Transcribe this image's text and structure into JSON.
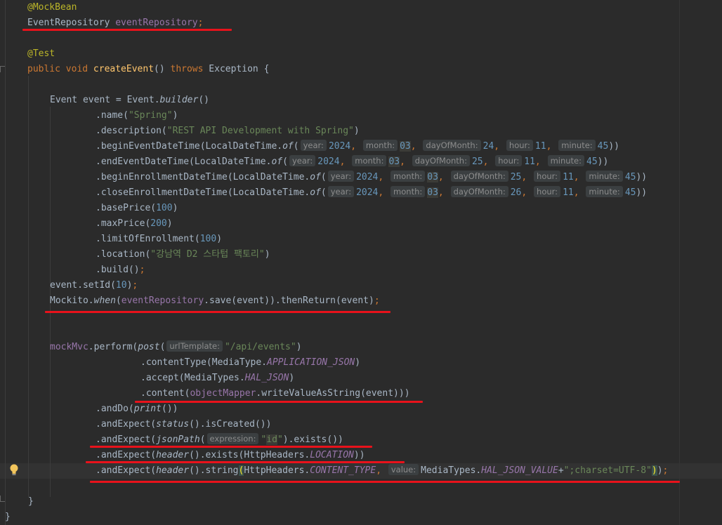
{
  "editor": {
    "lines": [
      {
        "tokens": [
          {
            "t": "@MockBean",
            "c": "ann"
          }
        ]
      },
      {
        "tokens": [
          {
            "t": "EventRepository ",
            "c": "plain"
          },
          {
            "t": "eventRepository",
            "c": "field"
          },
          {
            "t": ";",
            "c": "kw"
          }
        ]
      },
      {
        "tokens": []
      },
      {
        "tokens": [
          {
            "t": "@Test",
            "c": "ann"
          }
        ]
      },
      {
        "tokens": [
          {
            "t": "public void ",
            "c": "kw"
          },
          {
            "t": "createEvent",
            "c": "fn"
          },
          {
            "t": "() ",
            "c": "plain"
          },
          {
            "t": "throws ",
            "c": "kw"
          },
          {
            "t": "Exception {",
            "c": "plain"
          }
        ]
      },
      {
        "tokens": []
      },
      {
        "tokens": [
          {
            "t": "Event event = Event.",
            "c": "plain"
          },
          {
            "t": "builder",
            "c": "plain it"
          },
          {
            "t": "()",
            "c": "plain"
          }
        ]
      },
      {
        "tokens": [
          {
            "t": ".name(",
            "c": "plain"
          },
          {
            "t": "\"Spring\"",
            "c": "str"
          },
          {
            "t": ")",
            "c": "plain"
          }
        ]
      },
      {
        "tokens": [
          {
            "t": ".description(",
            "c": "plain"
          },
          {
            "t": "\"REST API Development with Spring\"",
            "c": "str"
          },
          {
            "t": ")",
            "c": "plain"
          }
        ]
      },
      {
        "tokens": [
          {
            "t": ".beginEventDateTime(LocalDateTime.",
            "c": "plain"
          },
          {
            "t": "of",
            "c": "plain it"
          },
          {
            "t": "(",
            "c": "plain"
          },
          {
            "h": "year:"
          },
          {
            "t": "2024",
            "c": "num"
          },
          {
            "t": ", ",
            "c": "kw"
          },
          {
            "h": "month:"
          },
          {
            "t": "03",
            "c": "num hl"
          },
          {
            "t": ", ",
            "c": "kw"
          },
          {
            "h": "dayOfMonth:"
          },
          {
            "t": "24",
            "c": "num"
          },
          {
            "t": ", ",
            "c": "kw"
          },
          {
            "h": "hour:"
          },
          {
            "t": "11",
            "c": "num"
          },
          {
            "t": ", ",
            "c": "kw"
          },
          {
            "h": "minute:"
          },
          {
            "t": "45",
            "c": "num"
          },
          {
            "t": "))",
            "c": "plain"
          }
        ]
      },
      {
        "tokens": [
          {
            "t": ".endEventDateTime(LocalDateTime.",
            "c": "plain"
          },
          {
            "t": "of",
            "c": "plain it"
          },
          {
            "t": "(",
            "c": "plain"
          },
          {
            "h": "year:"
          },
          {
            "t": "2024",
            "c": "num"
          },
          {
            "t": ", ",
            "c": "kw"
          },
          {
            "h": "month:"
          },
          {
            "t": "03",
            "c": "num hl"
          },
          {
            "t": ", ",
            "c": "kw"
          },
          {
            "h": "dayOfMonth:"
          },
          {
            "t": "25",
            "c": "num"
          },
          {
            "t": ", ",
            "c": "kw"
          },
          {
            "h": "hour:"
          },
          {
            "t": "11",
            "c": "num"
          },
          {
            "t": ", ",
            "c": "kw"
          },
          {
            "h": "minute:"
          },
          {
            "t": "45",
            "c": "num"
          },
          {
            "t": "))",
            "c": "plain"
          }
        ]
      },
      {
        "tokens": [
          {
            "t": ".beginEnrollmentDateTime(LocalDateTime.",
            "c": "plain"
          },
          {
            "t": "of",
            "c": "plain it"
          },
          {
            "t": "(",
            "c": "plain"
          },
          {
            "h": "year:"
          },
          {
            "t": "2024",
            "c": "num"
          },
          {
            "t": ", ",
            "c": "kw"
          },
          {
            "h": "month:"
          },
          {
            "t": "03",
            "c": "num hl"
          },
          {
            "t": ", ",
            "c": "kw"
          },
          {
            "h": "dayOfMonth:"
          },
          {
            "t": "25",
            "c": "num"
          },
          {
            "t": ", ",
            "c": "kw"
          },
          {
            "h": "hour:"
          },
          {
            "t": "11",
            "c": "num"
          },
          {
            "t": ", ",
            "c": "kw"
          },
          {
            "h": "minute:"
          },
          {
            "t": "45",
            "c": "num"
          },
          {
            "t": "))",
            "c": "plain"
          }
        ]
      },
      {
        "tokens": [
          {
            "t": ".closeEnrollmentDateTime(LocalDateTime.",
            "c": "plain"
          },
          {
            "t": "of",
            "c": "plain it"
          },
          {
            "t": "(",
            "c": "plain"
          },
          {
            "h": "year:"
          },
          {
            "t": "2024",
            "c": "num"
          },
          {
            "t": ", ",
            "c": "kw"
          },
          {
            "h": "month:"
          },
          {
            "t": "03",
            "c": "num hl"
          },
          {
            "t": ", ",
            "c": "kw"
          },
          {
            "h": "dayOfMonth:"
          },
          {
            "t": "26",
            "c": "num"
          },
          {
            "t": ", ",
            "c": "kw"
          },
          {
            "h": "hour:"
          },
          {
            "t": "11",
            "c": "num"
          },
          {
            "t": ", ",
            "c": "kw"
          },
          {
            "h": "minute:"
          },
          {
            "t": "45",
            "c": "num"
          },
          {
            "t": "))",
            "c": "plain"
          }
        ]
      },
      {
        "tokens": [
          {
            "t": ".basePrice(",
            "c": "plain"
          },
          {
            "t": "100",
            "c": "num"
          },
          {
            "t": ")",
            "c": "plain"
          }
        ]
      },
      {
        "tokens": [
          {
            "t": ".maxPrice(",
            "c": "plain"
          },
          {
            "t": "200",
            "c": "num"
          },
          {
            "t": ")",
            "c": "plain"
          }
        ]
      },
      {
        "tokens": [
          {
            "t": ".limitOfEnrollment(",
            "c": "plain"
          },
          {
            "t": "100",
            "c": "num"
          },
          {
            "t": ")",
            "c": "plain"
          }
        ]
      },
      {
        "tokens": [
          {
            "t": ".location(",
            "c": "plain"
          },
          {
            "t": "\"강남역 D2 스타텁 팩토리\"",
            "c": "str"
          },
          {
            "t": ")",
            "c": "plain"
          }
        ]
      },
      {
        "tokens": [
          {
            "t": ".build()",
            "c": "plain"
          },
          {
            "t": ";",
            "c": "kw"
          }
        ]
      },
      {
        "tokens": [
          {
            "t": "event.setId(",
            "c": "plain"
          },
          {
            "t": "10",
            "c": "num"
          },
          {
            "t": ")",
            "c": "plain"
          },
          {
            "t": ";",
            "c": "kw"
          }
        ]
      },
      {
        "tokens": [
          {
            "t": "Mockito.",
            "c": "plain"
          },
          {
            "t": "when",
            "c": "plain it"
          },
          {
            "t": "(",
            "c": "plain"
          },
          {
            "t": "eventRepository",
            "c": "field"
          },
          {
            "t": ".save(event)).thenReturn(event)",
            "c": "plain"
          },
          {
            "t": ";",
            "c": "kw"
          }
        ]
      },
      {
        "tokens": []
      },
      {
        "tokens": []
      },
      {
        "tokens": [
          {
            "t": "mockMvc",
            "c": "field"
          },
          {
            "t": ".perform(",
            "c": "plain"
          },
          {
            "t": "post",
            "c": "plain it"
          },
          {
            "t": "(",
            "c": "plain"
          },
          {
            "h": "urlTemplate:"
          },
          {
            "t": "\"/api/events\"",
            "c": "str"
          },
          {
            "t": ")",
            "c": "plain"
          }
        ]
      },
      {
        "tokens": [
          {
            "t": ".contentType(MediaType.",
            "c": "plain"
          },
          {
            "t": "APPLICATION_JSON",
            "c": "itfld"
          },
          {
            "t": ")",
            "c": "plain"
          }
        ]
      },
      {
        "tokens": [
          {
            "t": ".accept(MediaTypes.",
            "c": "plain"
          },
          {
            "t": "HAL_JSON",
            "c": "itfld"
          },
          {
            "t": ")",
            "c": "plain"
          }
        ]
      },
      {
        "tokens": [
          {
            "t": ".content(",
            "c": "plain"
          },
          {
            "t": "objectMapper",
            "c": "field"
          },
          {
            "t": ".writeValueAsString(event)))",
            "c": "plain"
          }
        ]
      },
      {
        "tokens": [
          {
            "t": ".andDo(",
            "c": "plain"
          },
          {
            "t": "print",
            "c": "plain it"
          },
          {
            "t": "())",
            "c": "plain"
          }
        ]
      },
      {
        "tokens": [
          {
            "t": ".andExpect(",
            "c": "plain"
          },
          {
            "t": "status",
            "c": "plain it"
          },
          {
            "t": "().isCreated())",
            "c": "plain"
          }
        ]
      },
      {
        "tokens": [
          {
            "t": ".andExpect(",
            "c": "plain"
          },
          {
            "t": "jsonPath",
            "c": "plain it"
          },
          {
            "t": "(",
            "c": "plain"
          },
          {
            "h": "expression:"
          },
          {
            "t": "\"",
            "c": "str"
          },
          {
            "t": "id",
            "c": "str hl"
          },
          {
            "t": "\"",
            "c": "str"
          },
          {
            "t": ").exists())",
            "c": "plain"
          }
        ]
      },
      {
        "tokens": [
          {
            "t": ".andExpect(",
            "c": "plain"
          },
          {
            "t": "header",
            "c": "plain it"
          },
          {
            "t": "().exists(HttpHeaders.",
            "c": "plain"
          },
          {
            "t": "LOCATION",
            "c": "itfld"
          },
          {
            "t": "))",
            "c": "plain"
          }
        ]
      },
      {
        "tokens": [
          {
            "t": ".andExpect(",
            "c": "plain"
          },
          {
            "t": "header",
            "c": "plain it"
          },
          {
            "t": "().string",
            "c": "plain"
          },
          {
            "t": "(",
            "c": "brk"
          },
          {
            "t": "HttpHeaders.",
            "c": "plain"
          },
          {
            "t": "CONTENT_TYPE",
            "c": "itfld"
          },
          {
            "t": ", ",
            "c": "kw"
          },
          {
            "h": "value:"
          },
          {
            "t": "MediaTypes.",
            "c": "plain"
          },
          {
            "t": "HAL_JSON_VALUE",
            "c": "itfld"
          },
          {
            "t": "+",
            "c": "plain"
          },
          {
            "t": "\";charset=UTF-8\"",
            "c": "str"
          },
          {
            "t": ")",
            "c": "brk"
          },
          {
            "t": ")",
            "c": "plain"
          },
          {
            "t": ";",
            "c": "kw"
          }
        ]
      },
      {
        "tokens": []
      },
      {
        "tokens": [
          {
            "t": "}",
            "c": "plain"
          }
        ]
      },
      {
        "tokens": [
          {
            "t": "}",
            "c": "plain"
          }
        ]
      }
    ]
  }
}
